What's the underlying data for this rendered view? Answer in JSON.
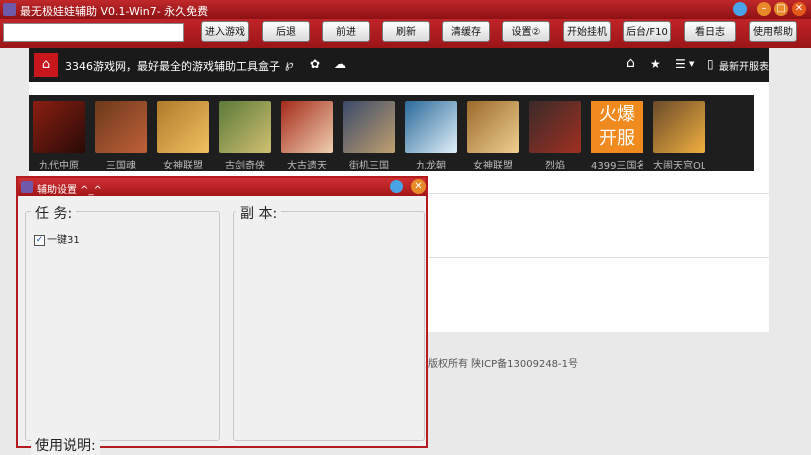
{
  "window": {
    "title": "最无极娃娃辅助 V0.1-Win7- 永久免费",
    "min_glyph": "–",
    "max_glyph": "□",
    "close_glyph": "✕"
  },
  "toolbar": {
    "address_value": "",
    "buttons": [
      "进入游戏",
      "后退",
      "前进",
      "刷新",
      "清缓存",
      "设置②",
      "开始挂机",
      "后台/F10",
      "看日志",
      "使用帮助"
    ]
  },
  "site": {
    "title": "3346游戏网，最好最全的游戏辅助工具盒子",
    "latest_label": "最新开服表",
    "icons": {
      "home": "⌂",
      "p": "℘",
      "weibo": "✿",
      "wechat": "☁",
      "house": "⌂",
      "star": "★",
      "menu": "☰",
      "mobile": "▯"
    },
    "games": [
      {
        "name": "九代中原",
        "color": "#8a1f12"
      },
      {
        "name": "三国魂",
        "color": "#6b3a1a"
      },
      {
        "name": "女神联盟",
        "color": "#b07a2a"
      },
      {
        "name": "古剑奇侠",
        "color": "#5b7a3a"
      },
      {
        "name": "大古遗天",
        "color": "#a42a1a"
      },
      {
        "name": "街机三国",
        "color": "#3a4a6a"
      },
      {
        "name": "九龙朝",
        "color": "#2a6a9a"
      },
      {
        "name": "女神联盟",
        "color": "#9a6a2a"
      },
      {
        "name": "烈焰",
        "color": "#3a2a2a"
      },
      {
        "name": "4399三国名",
        "color": "#f08a1e",
        "poster_lines": [
          "火爆",
          "开服"
        ]
      },
      {
        "name": "大闹天宫OL",
        "color": "#6a4a2a"
      }
    ],
    "footer": "版权所有 陕ICP备13009248-1号"
  },
  "dialog": {
    "title": "辅助设置 ^_^",
    "close_glyph": "✕",
    "task_label": "任  务:",
    "dungeon_label": "副  本:",
    "usage_label": "使用说明:",
    "checkbox_label": "一键31",
    "checkbox_checked": true,
    "check_glyph": "✓"
  }
}
